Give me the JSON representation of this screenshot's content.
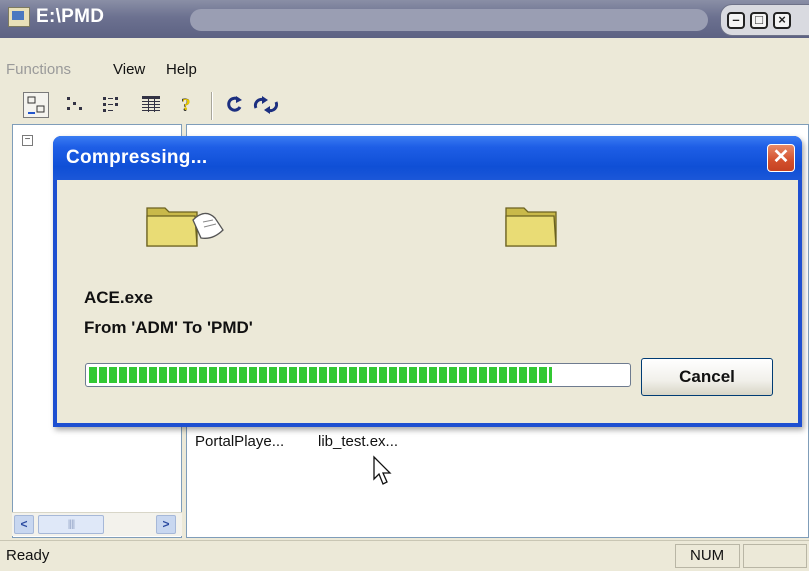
{
  "window": {
    "title": "E:\\PMD",
    "controls": {
      "minimize_icon": "minimize-icon",
      "maximize_icon": "maximize-icon",
      "close_icon": "close-icon"
    }
  },
  "menu": {
    "items": [
      {
        "label": "Functions",
        "enabled": false
      },
      {
        "label": "View",
        "enabled": true
      },
      {
        "label": "Help",
        "enabled": true
      }
    ]
  },
  "toolbar": {
    "buttons": [
      {
        "icon": "large-icons-view-icon",
        "active": true
      },
      {
        "icon": "small-icons-view-icon",
        "active": false
      },
      {
        "icon": "list-view-icon",
        "active": false
      },
      {
        "icon": "details-view-icon",
        "active": false
      },
      {
        "icon": "help-icon",
        "active": false
      },
      {
        "icon": "refresh-icon",
        "active": false
      },
      {
        "icon": "sync-icon",
        "active": false
      }
    ]
  },
  "tree": {
    "toggle": "−"
  },
  "files": [
    {
      "name": "PortalPlaye..."
    },
    {
      "name": "lib_test.ex..."
    }
  ],
  "dialog": {
    "title": "Compressing...",
    "close_label": "✕",
    "file_name": "ACE.exe",
    "from_to": "From 'ADM' To 'PMD'",
    "progress": 0.86,
    "cancel_label": "Cancel",
    "source_icon": "folder-with-document-icon",
    "destination_icon": "folder-icon"
  },
  "status": {
    "text": "Ready",
    "num": "NUM"
  },
  "colors": {
    "dialog_title": "#0f4fd6",
    "progress": "#32c832",
    "close": "#d3502c",
    "main_title": "#6c7190"
  }
}
